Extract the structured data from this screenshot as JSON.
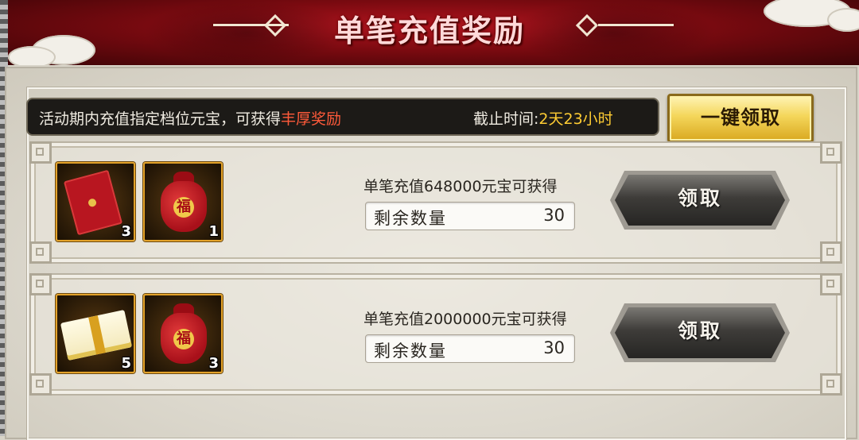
{
  "header": {
    "title": "单笔充值奖励"
  },
  "info_bar": {
    "text_prefix": "活动期内充值指定档位元宝，可获得",
    "text_highlight": "丰厚奖励",
    "deadline_label": "截止时间:",
    "deadline_value": "2天23小时"
  },
  "claim_all_label": "一键领取",
  "rows": [
    {
      "title": "单笔充值648000元宝可获得",
      "remaining_label": "剩余数量",
      "remaining_value": "30",
      "claim_label": "领取",
      "items": [
        {
          "icon": "red-envelope-icon",
          "count": "3"
        },
        {
          "icon": "lucky-bag-icon",
          "count": "1"
        }
      ]
    },
    {
      "title": "单笔充值2000000元宝可获得",
      "remaining_label": "剩余数量",
      "remaining_value": "30",
      "claim_label": "领取",
      "items": [
        {
          "icon": "gold-gift-box-icon",
          "count": "5"
        },
        {
          "icon": "lucky-bag-icon",
          "count": "3"
        }
      ]
    }
  ],
  "lucky_bag_char": "福",
  "colors": {
    "highlight": "#ff5a3a",
    "deadline": "#ffcc33",
    "header_red": "#9a0c14",
    "gold_button": "#f4d65a"
  }
}
